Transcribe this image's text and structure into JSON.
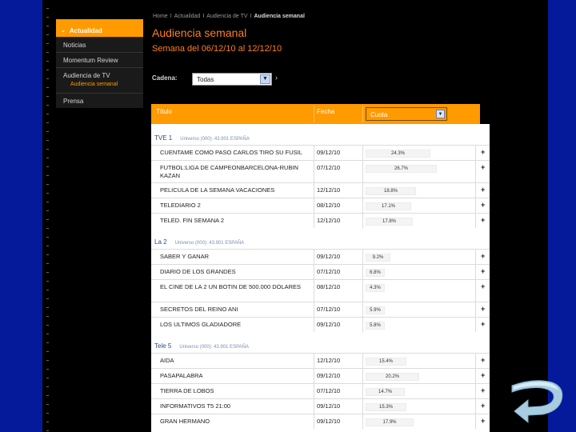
{
  "sidebar": {
    "active": "Actualidad",
    "items": [
      "Noticias",
      "Momentum Review"
    ],
    "group_label": "Audiencia de TV",
    "sub_item": "Audiencia semanal",
    "last": "Prensa"
  },
  "breadcrumb": [
    "Home",
    "Actualidad",
    "Audiencia de TV",
    "Audiencia semanal"
  ],
  "page": {
    "title": "Audiencia semanal",
    "subtitle": "Semana del 06/12/10 al 12/12/10"
  },
  "filter": {
    "label": "Cadena:",
    "value": "Todas"
  },
  "table": {
    "col_title": "Título",
    "col_date": "Fecha",
    "col_share": "Cuota",
    "groups": [
      {
        "name": "TVE 1",
        "universe": "Universo (000): 43.901 ESPAÑA",
        "rows": [
          {
            "title": "CUENTAME COMO PASO CARLOS TIRO SU FUSIL",
            "date": "09/12/10",
            "share": 24.3,
            "label": "24.3%"
          },
          {
            "title": "FUTBOL:LIGA DE CAMPEONBARCELONA-RUBIN KAZAN",
            "date": "07/12/10",
            "share": 26.7,
            "label": "26.7%"
          },
          {
            "title": "PELICULA DE LA SEMANA VACACIONES",
            "date": "12/12/10",
            "share": 18.8,
            "label": "18.8%"
          },
          {
            "title": "TELEDIARIO 2",
            "date": "08/12/10",
            "share": 17.1,
            "label": "17.1%"
          },
          {
            "title": "TELED. FIN SEMANA 2",
            "date": "12/12/10",
            "share": 17.8,
            "label": "17.8%"
          }
        ]
      },
      {
        "name": "La 2",
        "universe": "Universo (000): 43.901 ESPAÑA",
        "rows": [
          {
            "title": "SABER Y GANAR",
            "date": "09/12/10",
            "share": 9.2,
            "label": "9.2%"
          },
          {
            "title": "DIARIO DE LOS GRANDES",
            "date": "07/12/10",
            "share": 6.8,
            "label": "6.8%"
          },
          {
            "title": "EL CINE DE LA 2 UN BOTIN DE 500.000 DOLARES",
            "date": "08/12/10",
            "share": 4.3,
            "label": "4.3%"
          },
          {
            "title": "SECRETOS DEL REINO ANI",
            "date": "07/12/10",
            "share": 5.9,
            "label": "5.9%"
          },
          {
            "title": "LOS ULTIMOS GLADIADORE",
            "date": "09/12/10",
            "share": 5.8,
            "label": "5.8%"
          }
        ]
      },
      {
        "name": "Tele 5",
        "universe": "Universo (000): 43.901 ESPAÑA",
        "rows": [
          {
            "title": "AIDA",
            "date": "12/12/10",
            "share": 15.4,
            "label": "15.4%"
          },
          {
            "title": "PASAPALABRA",
            "date": "09/12/10",
            "share": 20.2,
            "label": "20.2%"
          },
          {
            "title": "TIERRA DE LOBOS",
            "date": "07/12/10",
            "share": 14.7,
            "label": "14.7%"
          },
          {
            "title": "INFORMATIVOS T5 21:00",
            "date": "09/12/10",
            "share": 15.3,
            "label": "15.3%"
          },
          {
            "title": "GRAN HERMANO",
            "date": "09/12/10",
            "share": 17.9,
            "label": "17.9%"
          }
        ]
      }
    ],
    "plus_symbol": "+"
  },
  "colors": {
    "accent": "#ff9a00",
    "title": "#ff7f1e",
    "slide_bg": "#041a9a",
    "panel_bg": "#000000"
  },
  "icons": {
    "back": "return-arrow-icon"
  }
}
